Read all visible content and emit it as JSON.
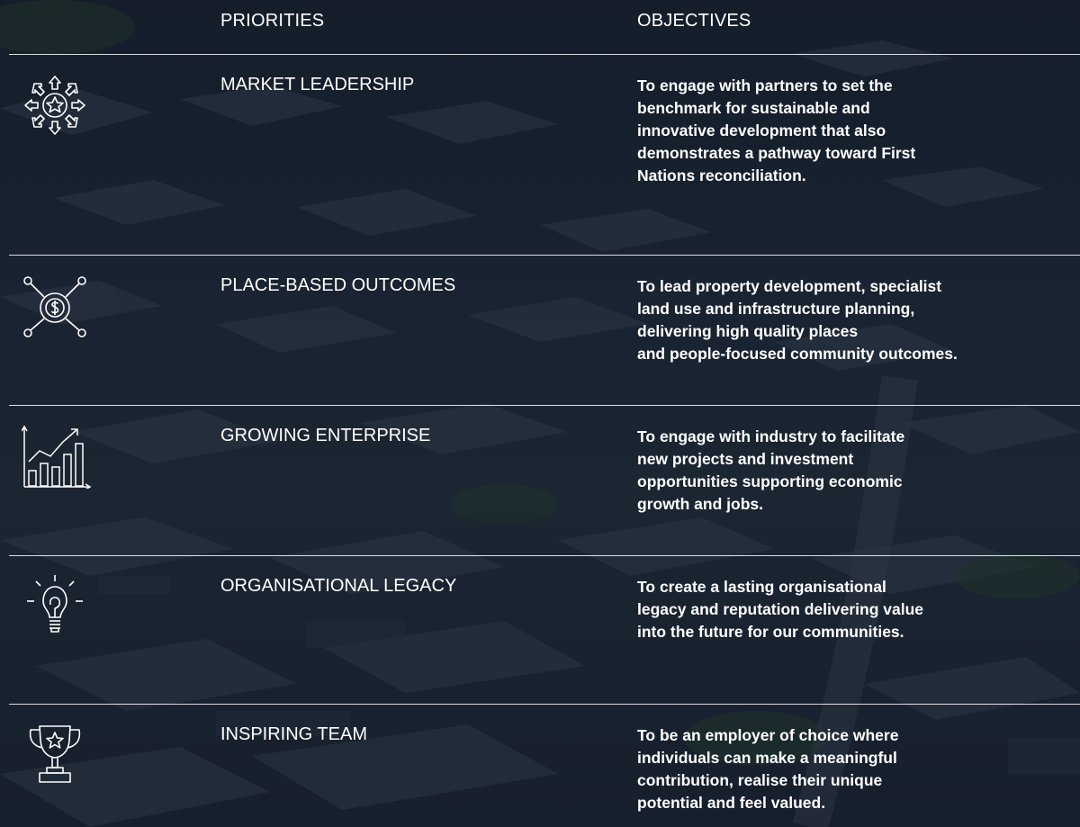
{
  "headers": {
    "priorities": "PRIORITIES",
    "objectives": "OBJECTIVES"
  },
  "rows": [
    {
      "icon": "star-arrows-icon",
      "title": "MARKET LEADERSHIP",
      "lines": [
        "To engage with partners to set the",
        "benchmark for sustainable and",
        "innovative development that also",
        "demonstrates a pathway toward First",
        "Nations reconciliation."
      ]
    },
    {
      "icon": "dollar-network-icon",
      "title": "PLACE-BASED OUTCOMES",
      "lines": [
        "To lead property development, specialist",
        "land use and infrastructure planning,",
        "delivering high quality places",
        "and people-focused community outcomes."
      ]
    },
    {
      "icon": "growth-chart-icon",
      "title": "GROWING ENTERPRISE",
      "lines": [
        "To engage with industry to facilitate",
        "new projects and investment",
        "opportunities supporting economic",
        "growth and jobs."
      ]
    },
    {
      "icon": "lightbulb-icon",
      "title": "ORGANISATIONAL LEGACY",
      "lines": [
        "To create a lasting organisational",
        "legacy and reputation delivering value",
        "into the future for our communities."
      ]
    },
    {
      "icon": "trophy-icon",
      "title": "INSPIRING TEAM",
      "lines": [
        "To be an employer of choice where",
        "individuals can make a meaningful",
        "contribution, realise their unique",
        "potential and feel valued."
      ]
    }
  ]
}
